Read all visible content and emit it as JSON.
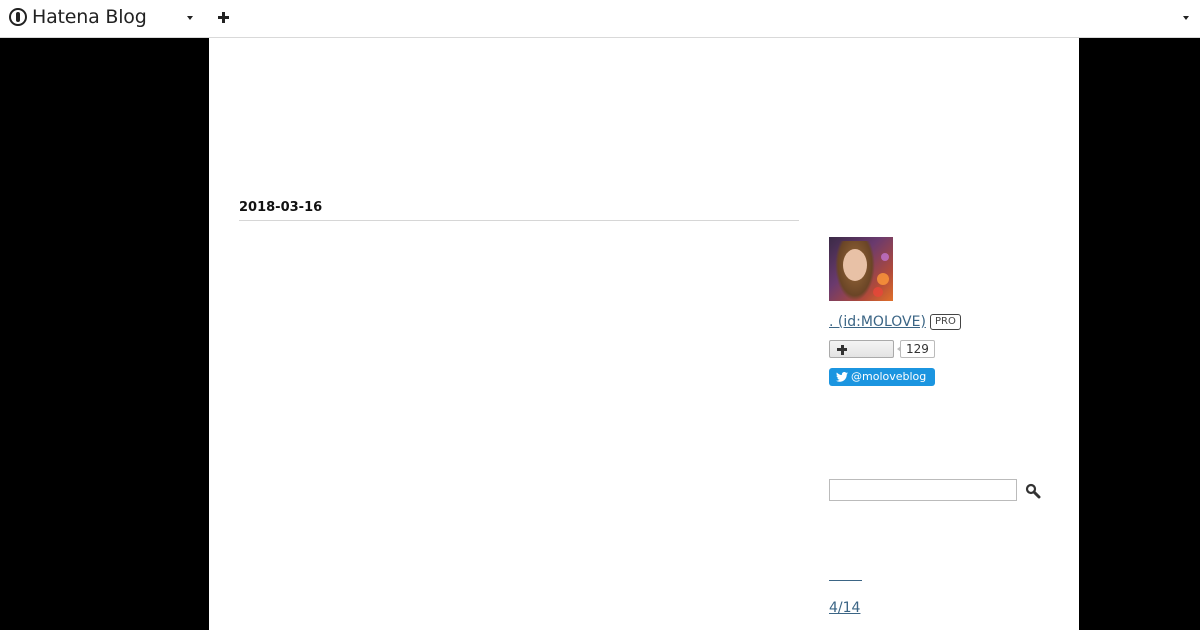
{
  "navbar": {
    "logo_text": "Hatena Blog",
    "menu_caret_icon": "chevron-down-icon",
    "add_icon": "plus-icon",
    "user_menu_icon": "chevron-down-icon"
  },
  "main": {
    "date_header": "2018-03-16"
  },
  "sidebar": {
    "profile": {
      "avatar": "profile-avatar",
      "name": ". (id:MOLOVE)",
      "badge": "PRO",
      "follow_icon": "plus-icon",
      "follower_count": "129",
      "twitter_handle": "@moloveblog"
    },
    "search": {
      "value": "",
      "placeholder": "",
      "icon": "search-icon"
    },
    "recent": {
      "archive_label": "4/14"
    }
  },
  "colors": {
    "link": "#3b6585",
    "twitter": "#1b95e0",
    "page_background": "#000000"
  }
}
